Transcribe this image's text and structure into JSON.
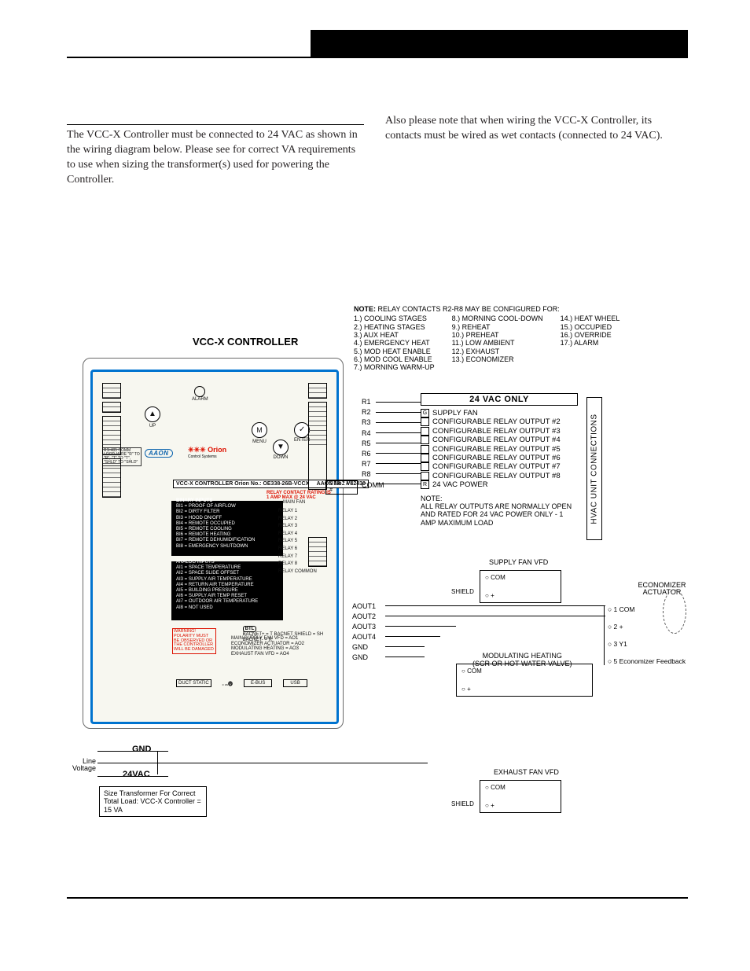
{
  "doc": {
    "intro_left": "The VCC-X Controller must be connected to 24 VAC as shown in the wiring diagram below.  Please see            for correct VA requirements to use when sizing the transformer(s) used for powering the Controller.",
    "intro_right": "Also please note that when wiring the VCC-X Controller, its contacts must be wired as wet contacts (connected to 24 VAC)."
  },
  "diagram": {
    "controller_title": "VCC-X CONTROLLER",
    "alarm": "ALARM",
    "buttons": {
      "menu": "MENU",
      "enter": "ENTER",
      "up": "UP",
      "down": "DOWN",
      "m": "M"
    },
    "rs485": "RS-485 COMM LOOP. WIRE \"R\" TO \"R\", \"T\" TO \"T\", \"SHLD\" TO \"SHLD\"",
    "aaon": "AAON",
    "orion": "✳✳✳ Orion",
    "orion_sub": "Control Systems",
    "model": "VCC-X CONTROLLER   Orion No.: OE338-26B-VCCX",
    "aaon_no": "AAON No.: V42430",
    "serial": "SERIAL #",
    "relay_rating": "RELAY CONTACT RATING IS 1 AMP MAX @ 24 VAC",
    "binary_hdr": "BINARY INPUTS",
    "binary": [
      "BI1 = PROOF OF AIRFLOW",
      "BI2 = DIRTY FILTER",
      "BI3 = HOOD ON/OFF",
      "BI4 = REMOTE OCCUPIED",
      "BI5 = REMOTE COOLING",
      "BI6 = REMOTE HEATING",
      "BI7 = REMOTE DEHUMIDIFICATION",
      "BI8 = EMERGENCY SHUTDOWN"
    ],
    "analog_hdr": "ANALOG INPUTS",
    "analog": [
      "AI1 = SPACE TEMPERATURE",
      "AI2 = SPACE SLIDE OFFSET",
      "AI3 = SUPPLY AIR TEMPERATURE",
      "AI4 = RETURN AIR TEMPERATURE",
      "AI5 = BUILDING PRESSURE",
      "AI6 = SUPPLY AIR TEMP RESET",
      "AI7 = OUTDOOR AIR TEMPERATURE",
      "AI8 = NOT USED"
    ],
    "mainfan": "MAIN FAN",
    "relay_list": [
      "RELAY 1",
      "RELAY 2",
      "RELAY 3",
      "RELAY 4",
      "RELAY 5",
      "RELAY 6",
      "RELAY 7",
      "RELAY 8",
      "RELAY COMMON"
    ],
    "warning": "WARNING! POLARITY MUST BE OBSERVED OR THE CONTROLLER WILL BE DAMAGED",
    "bacnet": "BACNET+ = T   BACNET SHIELD = SH   BACNET- = R",
    "aouts_map": "MAIN SUPPLY FAN VFD = AO1\nECONOMIZER ACTUATOR = AO2\nMODULATING HEATING = AO3\nEXHAUST FAN VFD = AO4",
    "btl": "BTL",
    "duct_static": "DUCT STATIC",
    "ebus": "E-BUS",
    "usb": "USB",
    "ul_us": "c   us",
    "note_hdr": "NOTE:",
    "note_text": "RELAY CONTACTS R2-R8 MAY BE CONFIGURED FOR:",
    "note_cols": {
      "c1": [
        "1.) COOLING STAGES",
        "2.) HEATING STAGES",
        "3.) AUX HEAT",
        "4.) EMERGENCY HEAT",
        "5.) MOD HEAT ENABLE",
        "6.) MOD COOL ENABLE",
        "7.) MORNING WARM-UP"
      ],
      "c2": [
        "8.) MORNING COOL-DOWN",
        "9.) REHEAT",
        "10.) PREHEAT",
        "11.) LOW AMBIENT",
        "12.) EXHAUST",
        "13.) ECONOMIZER"
      ],
      "c3": [
        "14.) HEAT WHEEL",
        "15.) OCCUPIED",
        "16.) OVERRIDE",
        "17.) ALARM"
      ]
    },
    "conn": {
      "title": "24 VAC ONLY",
      "rows": [
        {
          "tag": "G",
          "label": "SUPPLY FAN"
        },
        {
          "tag": "",
          "label": "CONFIGURABLE RELAY OUTPUT #2"
        },
        {
          "tag": "",
          "label": "CONFIGURABLE RELAY OUTPUT #3"
        },
        {
          "tag": "",
          "label": "CONFIGURABLE RELAY OUTPUT #4"
        },
        {
          "tag": "",
          "label": "CONFIGURABLE RELAY OUTPUT #5"
        },
        {
          "tag": "",
          "label": "CONFIGURABLE RELAY OUTPUT #6"
        },
        {
          "tag": "",
          "label": "CONFIGURABLE RELAY OUTPUT #7"
        },
        {
          "tag": "",
          "label": "CONFIGURABLE RELAY OUTPUT #8"
        },
        {
          "tag": "R",
          "label": "24 VAC POWER"
        }
      ],
      "note": "NOTE:\nALL RELAY OUTPUTS ARE NORMALLY OPEN AND RATED FOR 24 VAC POWER ONLY - 1 AMP MAXIMUM LOAD",
      "hvac": "HVAC UNIT CONNECTIONS"
    },
    "r_pins": [
      "R1",
      "R2",
      "R3",
      "R4",
      "R5",
      "R6",
      "R7",
      "R8",
      "COMM"
    ],
    "aout_pins": [
      "AOUT1",
      "AOUT2",
      "AOUT3",
      "AOUT4",
      "GND",
      "GND"
    ],
    "supply_vfd": "SUPPLY FAN VFD",
    "supply_terms": [
      "COM",
      "+"
    ],
    "mod_heat": "MODULATING HEATING\n(SCR OR HOT WATER VALVE)",
    "mod_terms": [
      "COM",
      "+"
    ],
    "exh_vfd": "EXHAUST FAN VFD",
    "exh_terms": [
      "COM",
      "+"
    ],
    "shield": "SHIELD",
    "econ": {
      "title": "ECONOMIZER ACTUATOR",
      "terms": [
        "1  COM",
        "2  +",
        "3  Y1",
        "5  Economizer Feedback"
      ]
    },
    "gnd": "GND",
    "vac24": "24VAC",
    "linev": "Line Voltage",
    "xfmr": "Size Transformer For Correct Total Load: VCC-X Controller = 15 VA"
  }
}
